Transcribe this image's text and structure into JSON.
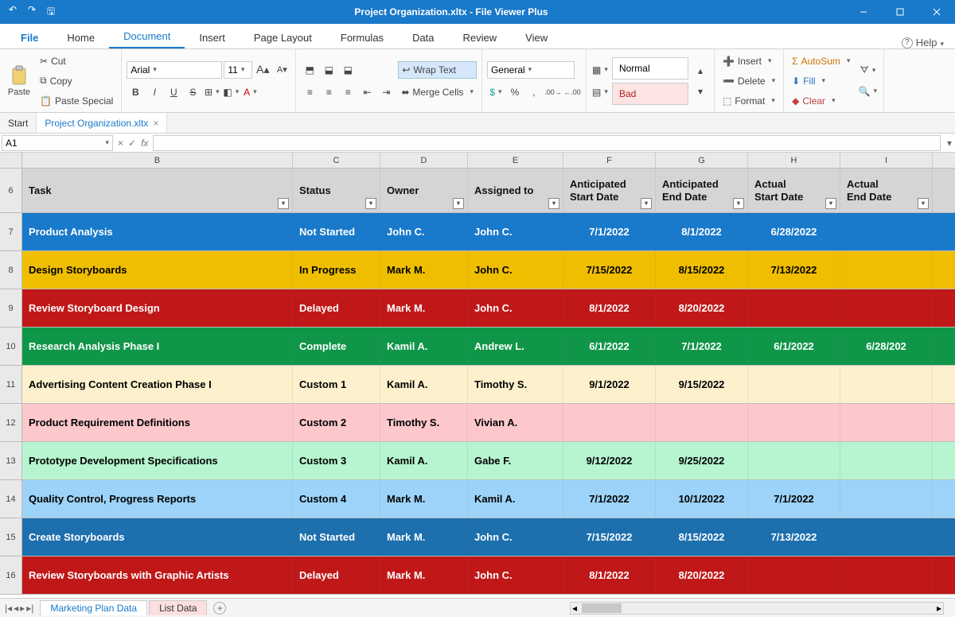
{
  "title": "Project Organization.xltx - File Viewer Plus",
  "tabs": {
    "file": "File",
    "home": "Home",
    "document": "Document",
    "insert": "Insert",
    "page": "Page Layout",
    "formulas": "Formulas",
    "data": "Data",
    "review": "Review",
    "view": "View",
    "help": "Help"
  },
  "clipboard": {
    "paste": "Paste",
    "cut": "Cut",
    "copy": "Copy",
    "special": "Paste Special"
  },
  "font": {
    "name": "Arial",
    "size": "11"
  },
  "wrap": "Wrap Text",
  "merge": "Merge Cells",
  "numfmt": "General",
  "styles": {
    "normal": "Normal",
    "bad": "Bad"
  },
  "cells": {
    "insert": "Insert",
    "delete": "Delete",
    "format": "Format"
  },
  "edit": {
    "autosum": "AutoSum",
    "fill": "Fill",
    "clear": "Clear"
  },
  "doc_tabs": {
    "start": "Start",
    "current": "Project Organization.xltx"
  },
  "name_box": "A1",
  "col_letters": [
    "B",
    "C",
    "D",
    "E",
    "F",
    "G",
    "H",
    "I"
  ],
  "headers": [
    "Task",
    "Status",
    "Owner",
    "Assigned to",
    "Anticipated Start Date",
    "Anticipated End Date",
    "Actual Start Date",
    "Actual End Date"
  ],
  "rows": [
    {
      "n": "7",
      "cls": "r-blue",
      "c": [
        "Product Analysis",
        "Not Started",
        "John C.",
        "John C.",
        "7/1/2022",
        "8/1/2022",
        "6/28/2022",
        ""
      ]
    },
    {
      "n": "8",
      "cls": "r-yellow",
      "c": [
        "Design Storyboards",
        "In Progress",
        "Mark M.",
        "John C.",
        "7/15/2022",
        "8/15/2022",
        "7/13/2022",
        ""
      ]
    },
    {
      "n": "9",
      "cls": "r-red",
      "c": [
        "Review Storyboard Design",
        "Delayed",
        "Mark M.",
        "John C.",
        "8/1/2022",
        "8/20/2022",
        "",
        ""
      ]
    },
    {
      "n": "10",
      "cls": "r-green",
      "c": [
        "Research Analysis Phase I",
        "Complete",
        "Kamil A.",
        "Andrew L.",
        "6/1/2022",
        "7/1/2022",
        "6/1/2022",
        "6/28/202"
      ]
    },
    {
      "n": "11",
      "cls": "r-cream",
      "c": [
        "Advertising Content Creation Phase I",
        "Custom 1",
        "Kamil A.",
        "Timothy S.",
        "9/1/2022",
        "9/15/2022",
        "",
        ""
      ]
    },
    {
      "n": "12",
      "cls": "r-pink",
      "c": [
        "Product Requirement Definitions",
        "Custom 2",
        "Timothy S.",
        "Vivian A.",
        "",
        "",
        "",
        ""
      ]
    },
    {
      "n": "13",
      "cls": "r-mint",
      "c": [
        "Prototype Development Specifications",
        "Custom 3",
        "Kamil A.",
        "Gabe F.",
        "9/12/2022",
        "9/25/2022",
        "",
        ""
      ]
    },
    {
      "n": "14",
      "cls": "r-lblue",
      "c": [
        "Quality Control, Progress Reports",
        "Custom 4",
        "Mark M.",
        "Kamil A.",
        "7/1/2022",
        "10/1/2022",
        "7/1/2022",
        ""
      ]
    },
    {
      "n": "15",
      "cls": "r-blue2",
      "c": [
        "Create Storyboards",
        "Not Started",
        "Mark M.",
        "John C.",
        "7/15/2022",
        "8/15/2022",
        "7/13/2022",
        ""
      ]
    },
    {
      "n": "16",
      "cls": "r-red2",
      "c": [
        "Review Storyboards with Graphic Artists",
        "Delayed",
        "Mark M.",
        "John C.",
        "8/1/2022",
        "8/20/2022",
        "",
        ""
      ]
    }
  ],
  "header_row_n": "6",
  "sheet_tabs": {
    "a": "Marketing Plan Data",
    "b": "List Data"
  }
}
